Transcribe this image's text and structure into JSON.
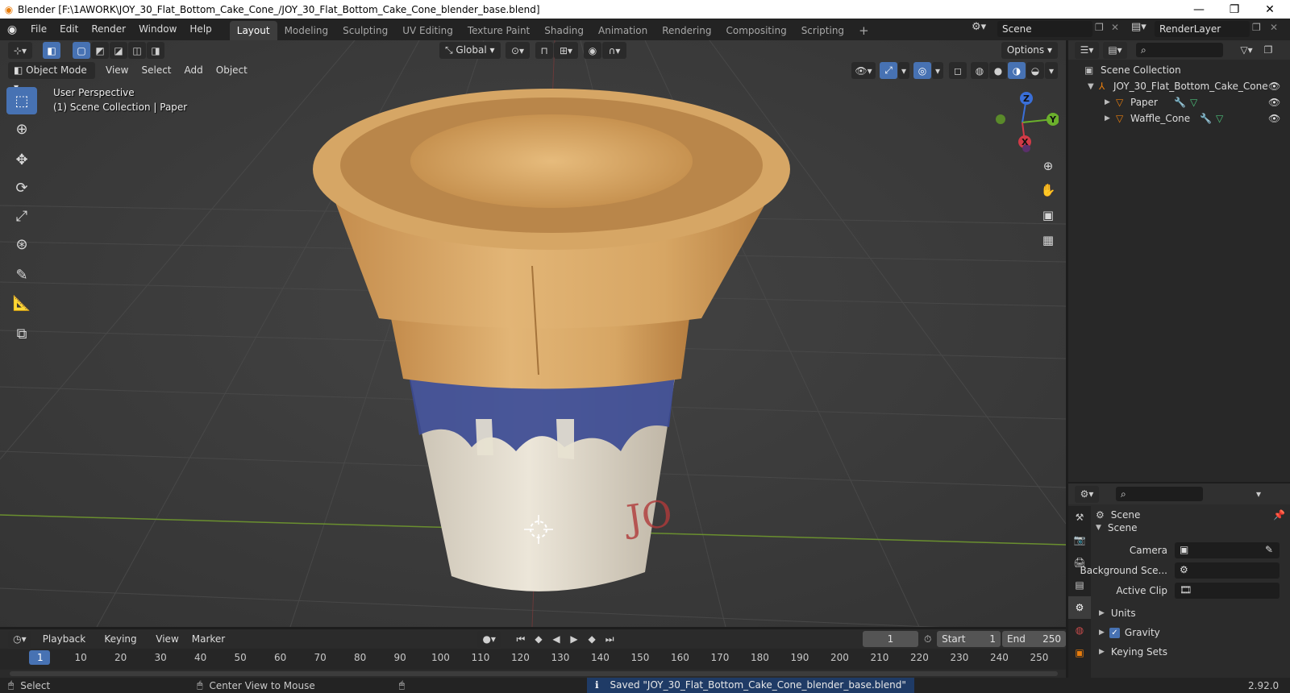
{
  "window": {
    "title": "Blender [F:\\1AWORK\\JOY_30_Flat_Bottom_Cake_Cone_/JOY_30_Flat_Bottom_Cake_Cone_blender_base.blend]",
    "minimize": "—",
    "restore": "❐",
    "close": "✕"
  },
  "menus": [
    "File",
    "Edit",
    "Render",
    "Window",
    "Help"
  ],
  "workspaces": [
    "Layout",
    "Modeling",
    "Sculpting",
    "UV Editing",
    "Texture Paint",
    "Shading",
    "Animation",
    "Rendering",
    "Compositing",
    "Scripting"
  ],
  "add_workspace": "+",
  "scene_field": "Scene",
  "render_layer_field": "RenderLayer",
  "viewport_header": {
    "transform_orientation": "Global",
    "options": "Options",
    "mode": "Object Mode",
    "menus": [
      "View",
      "Select",
      "Add",
      "Object"
    ]
  },
  "viewport_overlay": {
    "perspective": "User Perspective",
    "collection": "(1) Scene Collection | Paper"
  },
  "gizmo": {
    "z": "Z",
    "y": "Y",
    "x": "X"
  },
  "outliner": {
    "root": "Scene Collection",
    "items": [
      {
        "label": "JOY_30_Flat_Bottom_Cake_Cone",
        "level": 1
      },
      {
        "label": "Paper",
        "level": 2
      },
      {
        "label": "Waffle_Cone",
        "level": 2
      }
    ]
  },
  "properties": {
    "context": "Scene",
    "panel": "Scene",
    "camera_label": "Camera",
    "background_label": "Background Sce...",
    "active_clip_label": "Active Clip",
    "sections": [
      "Units",
      "Gravity",
      "Keying Sets"
    ],
    "gravity_checked": true
  },
  "timeline": {
    "menus": [
      "Playback",
      "Keying",
      "View",
      "Marker"
    ],
    "current_frame": "1",
    "start_label": "Start",
    "start_value": "1",
    "end_label": "End",
    "end_value": "250",
    "ruler": [
      "1",
      "10",
      "20",
      "30",
      "40",
      "50",
      "60",
      "70",
      "80",
      "90",
      "100",
      "110",
      "120",
      "130",
      "140",
      "150",
      "160",
      "170",
      "180",
      "190",
      "200",
      "210",
      "220",
      "230",
      "240",
      "250"
    ]
  },
  "statusbar": {
    "select": "Select",
    "center_view": "Center View to Mouse",
    "message": "Saved \"JOY_30_Flat_Bottom_Cake_Cone_blender_base.blend\"",
    "version": "2.92.0"
  },
  "colors": {
    "accent": "#4772b3",
    "orange": "#e87d0d",
    "grid_green": "#6a8f2f",
    "cone": "#d9a865",
    "paper_blue": "#3b4a93"
  }
}
